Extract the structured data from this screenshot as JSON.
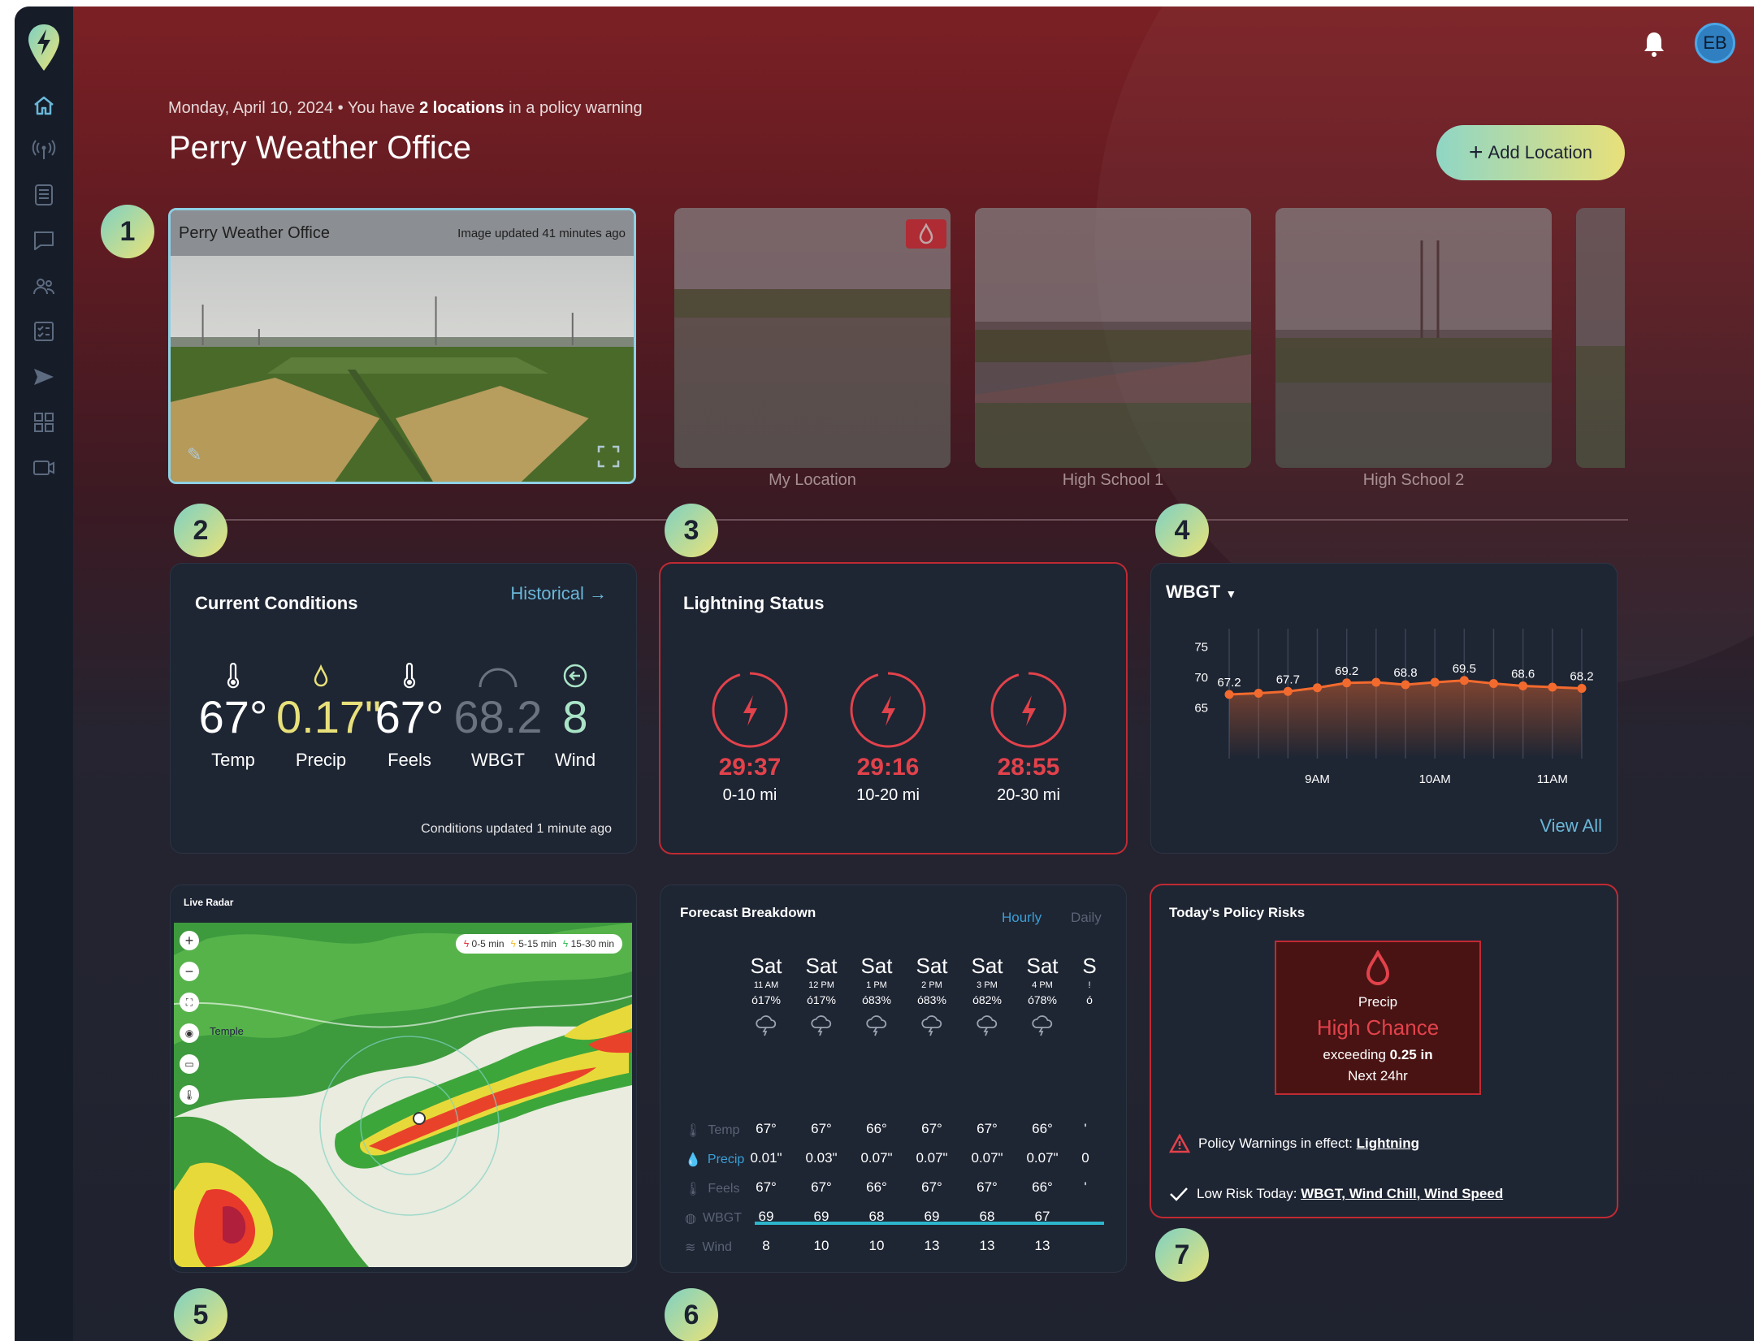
{
  "header": {
    "date": "Monday, April 10, 2024",
    "warning_pre": " • You have ",
    "warning_count": "2 locations",
    "warning_post": " in a policy warning",
    "title": "Perry Weather Office",
    "add_location": "Add Location",
    "avatar": "EB"
  },
  "sidebar": {
    "items": [
      "home-icon",
      "antenna-icon",
      "radar-layers-icon",
      "chat-icon",
      "users-icon",
      "checklist-icon",
      "send-icon",
      "apps-icon",
      "camera-icon"
    ]
  },
  "cameras": {
    "main": {
      "name": "Perry Weather Office",
      "updated": "Image updated 41 minutes ago"
    },
    "thumbs": [
      "My Location",
      "High School 1",
      "High School 2"
    ]
  },
  "markers": [
    "1",
    "2",
    "3",
    "4",
    "5",
    "6",
    "7"
  ],
  "current_conditions": {
    "title": "Current Conditions",
    "historical": "Historical →",
    "metrics": [
      {
        "value": "67°",
        "label": "Temp",
        "color": "#ffffff"
      },
      {
        "value": "0.17\"",
        "label": "Precip",
        "color": "#e8e07a"
      },
      {
        "value": "67°",
        "label": "Feels",
        "color": "#ffffff"
      },
      {
        "value": "68.2",
        "label": "WBGT",
        "color": "#6b7280"
      },
      {
        "value": "8",
        "label": "Wind",
        "color": "#a9e4c6"
      }
    ],
    "updated": "Conditions updated 1 minute ago"
  },
  "lightning": {
    "title": "Lightning Status",
    "zones": [
      {
        "time": "29:37",
        "range": "0-10 mi"
      },
      {
        "time": "29:16",
        "range": "10-20 mi"
      },
      {
        "time": "28:55",
        "range": "20-30 mi"
      }
    ]
  },
  "wbgt": {
    "selector": "WBGT",
    "view_all": "View All"
  },
  "chart_data": {
    "type": "line",
    "y_ticks": [
      "75",
      "70",
      "65"
    ],
    "ylim": [
      62,
      78
    ],
    "x_ticks": [
      {
        "label": "9AM",
        "index": 3
      },
      {
        "label": "10AM",
        "index": 7
      },
      {
        "label": "11AM",
        "index": 11
      }
    ],
    "values": [
      67.2,
      67.4,
      67.7,
      68.3,
      69.1,
      69.2,
      68.8,
      69.2,
      69.5,
      69.0,
      68.6,
      68.4,
      68.2
    ],
    "point_labels": [
      {
        "index": 0,
        "text": "67.2"
      },
      {
        "index": 2,
        "text": "67.7"
      },
      {
        "index": 4,
        "text": "69.2"
      },
      {
        "index": 6,
        "text": "68.8"
      },
      {
        "index": 8,
        "text": "69.5"
      },
      {
        "index": 10,
        "text": "68.6"
      },
      {
        "index": 12,
        "text": "68.2"
      }
    ],
    "line_color": "#f26a2e"
  },
  "radar": {
    "title": "Live Radar",
    "legend": [
      "0-5 min",
      "5-15 min",
      "15-30 min"
    ],
    "legend_colors": [
      "#e43840",
      "#f0c33c",
      "#3fbf62"
    ],
    "place": "Temple"
  },
  "forecast": {
    "title": "Forecast Breakdown",
    "tabs": [
      "Hourly",
      "Daily"
    ],
    "columns": [
      {
        "day": "Sat",
        "hour": "11 AM",
        "pop": "ó17%"
      },
      {
        "day": "Sat",
        "hour": "12 PM",
        "pop": "ó17%"
      },
      {
        "day": "Sat",
        "hour": "1 PM",
        "pop": "ó83%"
      },
      {
        "day": "Sat",
        "hour": "2 PM",
        "pop": "ó83%"
      },
      {
        "day": "Sat",
        "hour": "3 PM",
        "pop": "ó82%"
      },
      {
        "day": "Sat",
        "hour": "4 PM",
        "pop": "ó78%"
      },
      {
        "day": "S",
        "hour": "!",
        "pop": "ó"
      }
    ],
    "row_labels": [
      "Temp",
      "Precip",
      "Feels",
      "WBGT",
      "Wind"
    ],
    "rows": [
      [
        "67°",
        "67°",
        "66°",
        "67°",
        "67°",
        "66°",
        "'"
      ],
      [
        "0.01\"",
        "0.03\"",
        "0.07\"",
        "0.07\"",
        "0.07\"",
        "0.07\"",
        "0"
      ],
      [
        "67°",
        "67°",
        "66°",
        "67°",
        "67°",
        "66°",
        "'"
      ],
      [
        "69",
        "69",
        "68",
        "69",
        "68",
        "67",
        ""
      ],
      [
        "8",
        "10",
        "10",
        "13",
        "13",
        "13",
        ""
      ]
    ]
  },
  "policy": {
    "title": "Today's Policy Risks",
    "label": "Precip",
    "chance": "High Chance",
    "exceeding": "exceeding ",
    "amount": "0.25 in",
    "window": "Next 24hr",
    "warning_label": "Policy Warnings in effect: ",
    "warning_value": "Lightning",
    "low_label": "Low Risk Today: ",
    "low_value": "WBGT, Wind Chill, Wind Speed"
  }
}
